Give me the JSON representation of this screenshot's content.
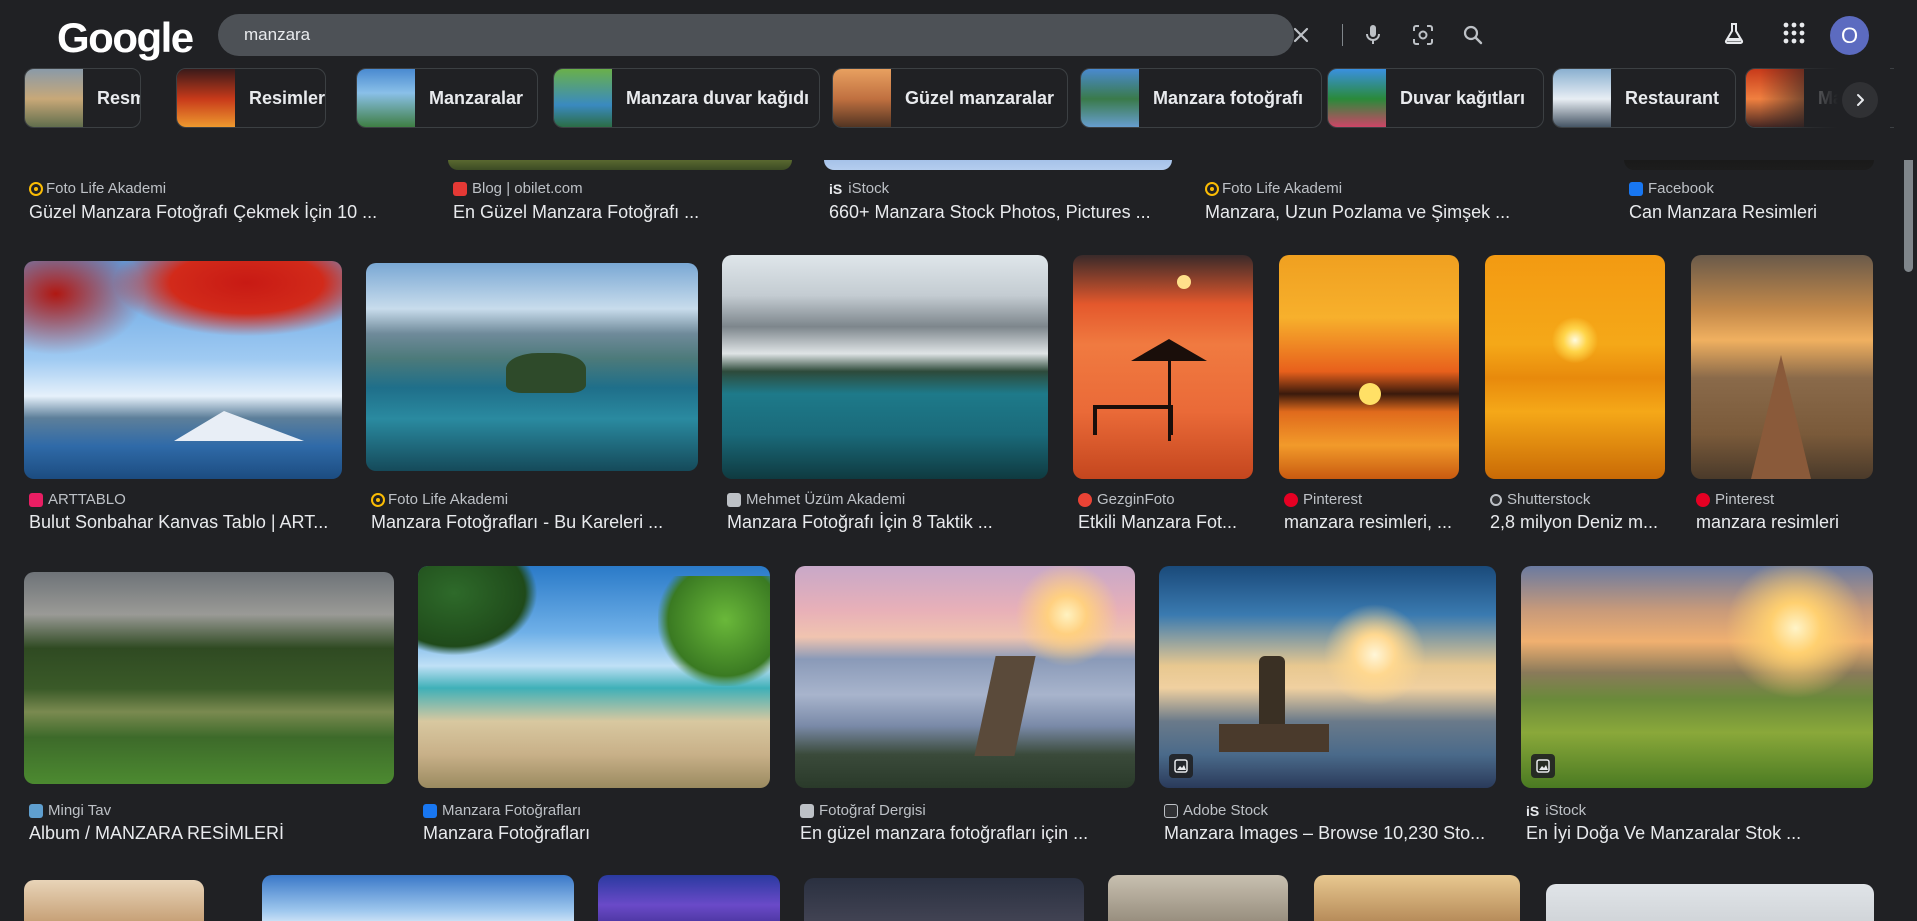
{
  "header": {
    "logo": "Google",
    "search_value": "manzara",
    "avatar_initial": "O"
  },
  "chips": [
    {
      "label": "Resmi"
    },
    {
      "label": "Resimleri"
    },
    {
      "label": "Manzaralar"
    },
    {
      "label": "Manzara duvar kağıdı"
    },
    {
      "label": "Güzel manzaralar"
    },
    {
      "label": "Manzara fotoğrafı"
    },
    {
      "label": "Duvar kağıtları"
    },
    {
      "label": "Restaurant"
    },
    {
      "label": "Ma"
    }
  ],
  "row1": [
    {
      "source": "Foto Life Akademi",
      "title": "Güzel Manzara Fotoğrafı Çekmek İçin 10 ..."
    },
    {
      "source": "Blog | obilet.com",
      "title": "En Güzel Manzara Fotoğrafı ..."
    },
    {
      "source": "iStock",
      "title": "660+ Manzara Stock Photos, Pictures ..."
    },
    {
      "source": "Foto Life Akademi",
      "title": "Manzara, Uzun Pozlama ve Şimşek ..."
    },
    {
      "source": "Facebook",
      "title": "Can Manzara Resimleri"
    }
  ],
  "row2": [
    {
      "source": "ARTTABLO",
      "title": "Bulut Sonbahar Kanvas Tablo | ART..."
    },
    {
      "source": "Foto Life Akademi",
      "title": "Manzara Fotoğrafları - Bu Kareleri ..."
    },
    {
      "source": "Mehmet Üzüm Akademi",
      "title": "Manzara Fotoğrafı İçin 8 Taktik ..."
    },
    {
      "source": "GezginFoto",
      "title": "Etkili Manzara Fot..."
    },
    {
      "source": "Pinterest",
      "title": "manzara resimleri, ..."
    },
    {
      "source": "Shutterstock",
      "title": "2,8 milyon Deniz m..."
    },
    {
      "source": "Pinterest",
      "title": "manzara resimleri"
    }
  ],
  "row3": [
    {
      "source": "Mingi Tav",
      "title": "Album / MANZARA RESİMLERİ"
    },
    {
      "source": "Manzara Fotoğrafları",
      "title": "Manzara Fotoğrafları"
    },
    {
      "source": "Fotoğraf Dergisi",
      "title": "En güzel manzara fotoğrafları için ..."
    },
    {
      "source": "Adobe Stock",
      "title": "Manzara Images – Browse 10,230 Sto..."
    },
    {
      "source": "iStock",
      "title": "En İyi Doğa Ve Manzaralar Stok ..."
    }
  ],
  "icons": {
    "clear": "close-icon",
    "voice": "microphone-icon",
    "lens": "lens-icon",
    "search": "search-icon",
    "labs": "labs-flask-icon",
    "apps": "apps-grid-icon",
    "next": "chevron-right-icon"
  },
  "colors": {
    "background": "#202124",
    "search_bar": "#4d5156",
    "avatar": "#5c6bc0"
  }
}
